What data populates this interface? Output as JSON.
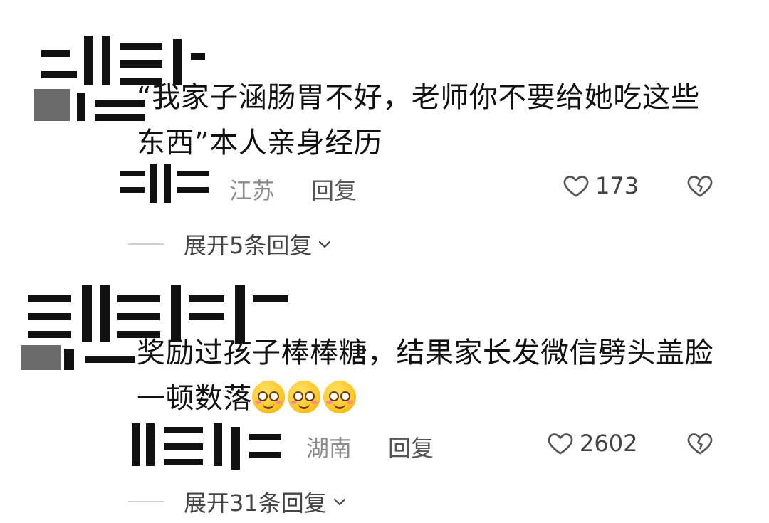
{
  "comments": [
    {
      "text_line1": "“我家子涵肠胃不好，老师你不要给她吃这些",
      "text_line2": "东西”本人亲身经历",
      "location": "江苏",
      "reply_label": "回复",
      "like_count": "173",
      "expand_label": "展开5条回复"
    },
    {
      "text_line1": "奖励过孩子棒棒糖，结果家长发微信劈头盖脸",
      "text_line2": "一顿数落",
      "location": "湖南",
      "reply_label": "回复",
      "like_count": "2602",
      "expand_label": "展开31条回复"
    }
  ],
  "icons": {
    "like": "heart-outline-icon",
    "dislike": "broken-heart-icon",
    "expand": "chevron-down-icon",
    "emoji": "smiling-face-emoji"
  },
  "colors": {
    "text": "#111111",
    "meta": "#8b8b8b",
    "emoji": "#ffc52a"
  }
}
